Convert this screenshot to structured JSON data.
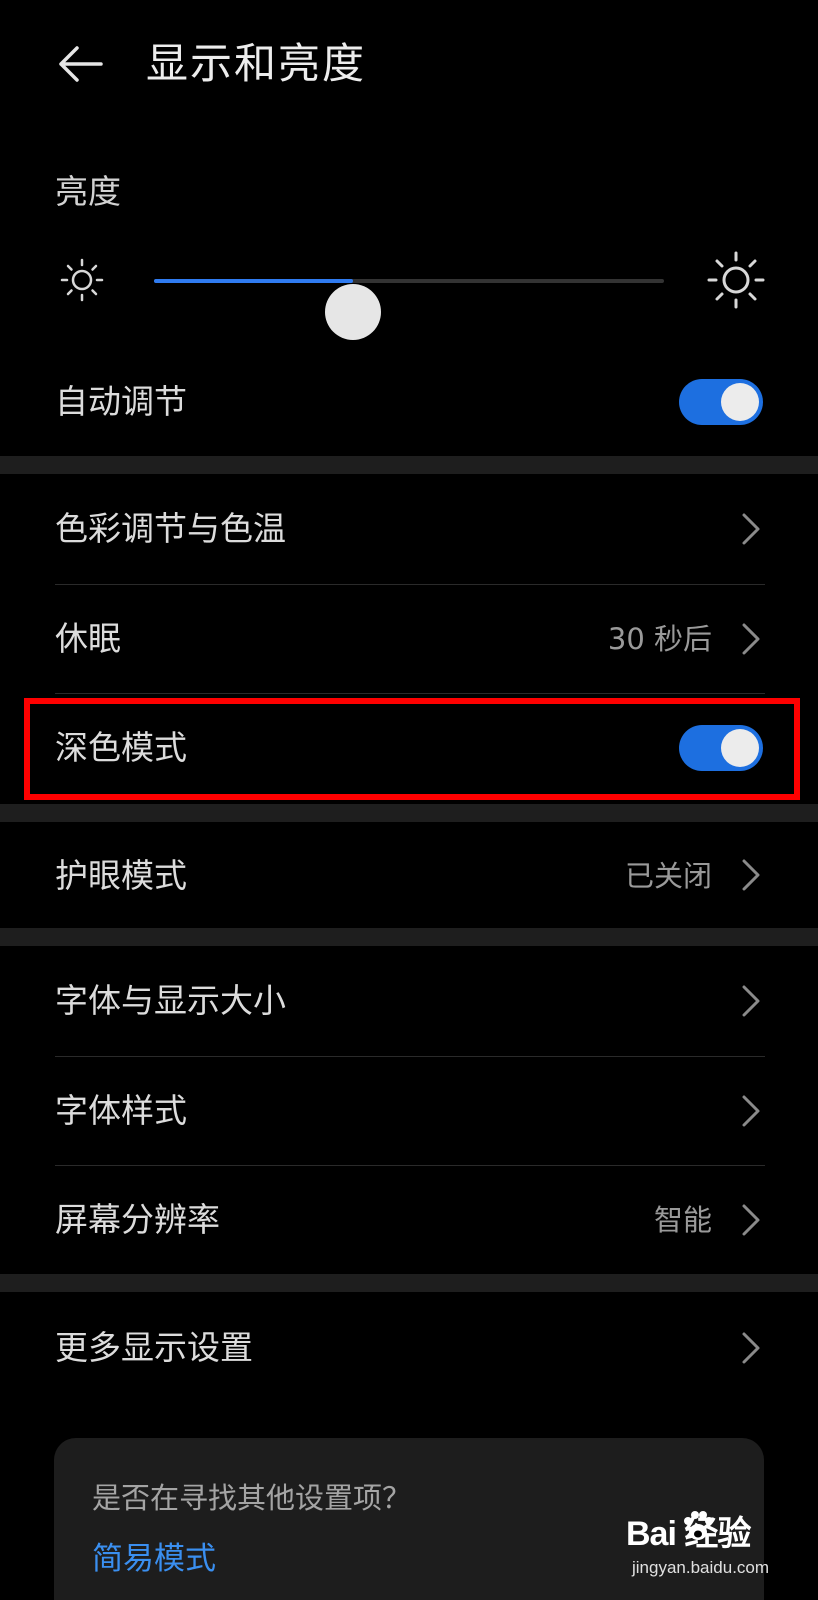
{
  "header": {
    "title": "显示和亮度"
  },
  "brightness": {
    "label": "亮度",
    "level_fraction": 0.39
  },
  "auto_adjust": {
    "label": "自动调节",
    "enabled": true
  },
  "colors": {
    "accent": "#2f7bf0",
    "toggle_on": "#1d6fe0",
    "highlight": "#ff0000",
    "link": "#3a8ff0"
  },
  "rows": {
    "color_temp": {
      "label": "色彩调节与色温"
    },
    "sleep": {
      "label": "休眠",
      "value": "30 秒后"
    },
    "dark_mode": {
      "label": "深色模式",
      "enabled": true
    },
    "eye_comfort": {
      "label": "护眼模式",
      "value": "已关闭"
    },
    "font_display_size": {
      "label": "字体与显示大小"
    },
    "font_style": {
      "label": "字体样式"
    },
    "resolution": {
      "label": "屏幕分辨率",
      "value": "智能"
    },
    "more_display": {
      "label": "更多显示设置"
    }
  },
  "suggestion_card": {
    "question": "是否在寻找其他设置项？",
    "link": "简易模式"
  },
  "watermark": {
    "brand": "Bai  经验",
    "url": "jingyan.baidu.com"
  }
}
